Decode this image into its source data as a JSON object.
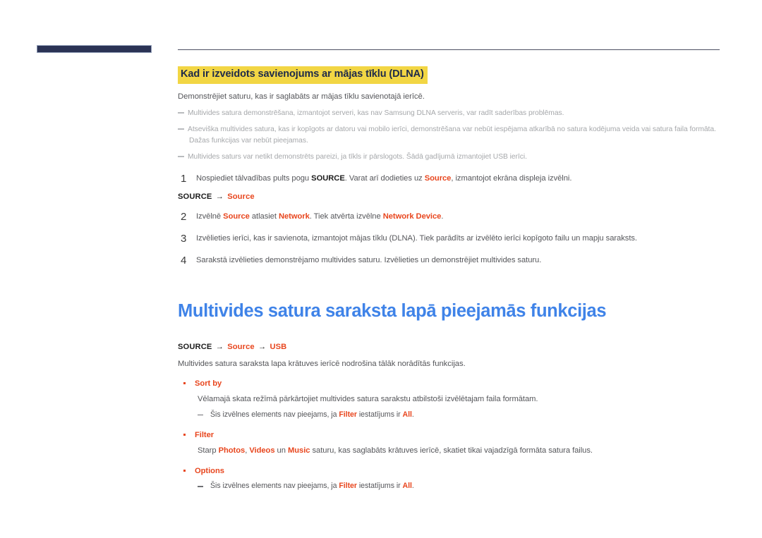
{
  "header": {
    "bar_color": "#2b3355",
    "rule_color": "#4c4f63"
  },
  "section": {
    "highlight_heading": "Kad ir izveidots savienojums ar mājas tīklu (DLNA)",
    "highlight_bg": "#f2d644",
    "intro": "Demonstrējiet saturu, kas ir saglabāts ar mājas tīklu savienotajā ierīcē.",
    "notes": [
      {
        "text": "Multivides satura demonstrēšana, izmantojot serveri, kas nav Samsung DLNA serveris, var radīt saderības problēmas."
      },
      {
        "text": "Atseviška multivides satura, kas ir kopīgots ar datoru vai mobilo ierīci, demonstrēšana var nebūt iespējama atkarībā no satura kodējuma veida vai satura faila formāta.",
        "continuation": "Dažas funkcijas var nebūt pieejamas."
      },
      {
        "text": "Multivides saturs var netikt demonstrēts pareizi, ja tīkls ir pārslogots. Šādā gadījumā izmantojiet USB ierīci."
      }
    ],
    "steps": [
      {
        "num": "1",
        "parts": [
          {
            "type": "plain",
            "text": "Nospiediet tālvadības pults pogu "
          },
          {
            "type": "key",
            "text": "SOURCE"
          },
          {
            "type": "plain",
            "text": ". Varat arī dodieties uz "
          },
          {
            "type": "orange",
            "text": "Source"
          },
          {
            "type": "plain",
            "text": ", izmantojot ekrāna displeja izvēlni."
          }
        ],
        "breadcrumb": {
          "root": "SOURCE",
          "arrow": "→",
          "items": [
            "Source"
          ]
        }
      },
      {
        "num": "2",
        "parts": [
          {
            "type": "plain",
            "text": "Izvēlnē "
          },
          {
            "type": "orange",
            "text": "Source"
          },
          {
            "type": "plain",
            "text": " atlasiet "
          },
          {
            "type": "orange",
            "text": "Network"
          },
          {
            "type": "plain",
            "text": ". Tiek atvērta izvēlne "
          },
          {
            "type": "orange",
            "text": "Network Device"
          },
          {
            "type": "plain",
            "text": "."
          }
        ]
      },
      {
        "num": "3",
        "parts": [
          {
            "type": "plain",
            "text": "Izvēlieties ierīci, kas ir savienota, izmantojot mājas tīklu (DLNA). Tiek parādīts ar izvēlēto ierīci kopīgoto failu un mapju saraksts."
          }
        ]
      },
      {
        "num": "4",
        "parts": [
          {
            "type": "plain",
            "text": "Sarakstā izvēlieties demonstrējamo multivides saturu. Izvēlieties un demonstrējiet multivides saturu."
          }
        ]
      }
    ]
  },
  "section2": {
    "title": "Multivides satura saraksta lapā pieejamās funkcijas",
    "title_color": "#3f83e8",
    "breadcrumb": {
      "root": "SOURCE",
      "arrow": "→",
      "items": [
        "Source",
        "USB"
      ]
    },
    "intro": "Multivides satura saraksta lapa krātuves ierīcē nodrošina tālāk norādītās funkcijas.",
    "bullets": [
      {
        "title": "Sort by",
        "body_parts": [
          {
            "type": "plain",
            "text": "Vēlamajā skata režīmā pārkārtojiet multivides satura sarakstu atbilstoši izvēlētajam faila formātam."
          }
        ],
        "subnotes": [
          {
            "parts": [
              {
                "type": "plain",
                "text": "Šis izvēlnes elements nav pieejams, ja "
              },
              {
                "type": "orange",
                "text": "Filter"
              },
              {
                "type": "plain",
                "text": " iestatījums ir "
              },
              {
                "type": "orange",
                "text": "All"
              },
              {
                "type": "plain",
                "text": "."
              }
            ]
          }
        ]
      },
      {
        "title": "Filter",
        "body_parts": [
          {
            "type": "plain",
            "text": "Starp "
          },
          {
            "type": "orange",
            "text": "Photos"
          },
          {
            "type": "plain",
            "text": ", "
          },
          {
            "type": "orange",
            "text": "Videos"
          },
          {
            "type": "plain",
            "text": " un "
          },
          {
            "type": "orange",
            "text": "Music"
          },
          {
            "type": "plain",
            "text": " saturu, kas saglabāts krātuves ierīcē, skatiet tikai vajadzīgā formāta satura failus."
          }
        ],
        "subnotes": []
      },
      {
        "title": "Options",
        "body_parts": [],
        "subnotes": [
          {
            "parts": [
              {
                "type": "plain",
                "text": "Šis izvēlnes elements nav pieejams, ja "
              },
              {
                "type": "orange",
                "text": "Filter"
              },
              {
                "type": "plain",
                "text": " iestatījums ir "
              },
              {
                "type": "orange",
                "text": "All"
              },
              {
                "type": "plain",
                "text": "."
              }
            ]
          }
        ]
      }
    ]
  }
}
